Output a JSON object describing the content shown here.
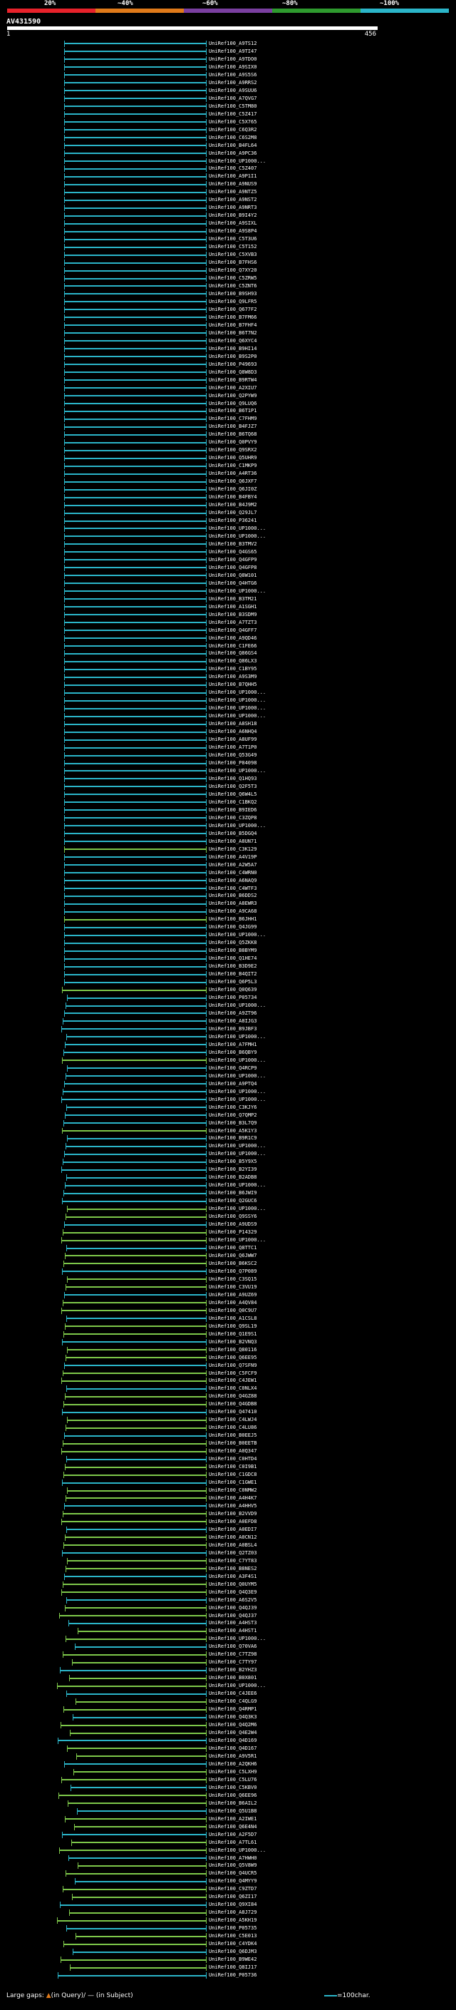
{
  "legend": {
    "labels": [
      "20%",
      "~40%",
      "~60%",
      "~80%",
      "~100%"
    ],
    "colors": [
      "#e8222b",
      "#e07a1a",
      "#7a3fa0",
      "#2e9a2e",
      "#2bb5c9"
    ]
  },
  "query_id": "AV431590",
  "scale": {
    "start": "1",
    "end": "456"
  },
  "palette": {
    "high": "#2bb5c9",
    "mid": "#7ec84a",
    "row_bg": "#1a2330"
  },
  "rows": [
    "UniRef100_A9TS12",
    "UniRef100_A9TI47",
    "UniRef100_A9TDO0",
    "UniRef100_A9SIX0",
    "UniRef100_A9S5S6",
    "UniRef100_A9RRS2",
    "UniRef100_A9SUU6",
    "UniRef100_A7QVG7",
    "UniRef100_C5TM80",
    "UniRef100_C5Z417",
    "UniRef100_C5X765",
    "UniRef100_C6Q3R2",
    "UniRef100_C6S2M8",
    "UniRef100_B4FL64",
    "UniRef100_A9PC36",
    "UniRef100_UP1000...",
    "UniRef100_C5Z407",
    "UniRef100_A9P1I1",
    "UniRef100_A9NUS9",
    "UniRef100_A9NTZ5",
    "UniRef100_A9NST2",
    "UniRef100_A9NRT3",
    "UniRef100_B9I4Y2",
    "UniRef100_A9SIXL",
    "UniRef100_A9S8P4",
    "UniRef100_C5T3U6",
    "UniRef100_C5T152",
    "UniRef100_C5XVB3",
    "UniRef100_B7FHS6",
    "UniRef100_Q7XY20",
    "UniRef100_C5ZRW5",
    "UniRef100_C5ZNT6",
    "UniRef100_B9SH93",
    "UniRef100_Q9LFR5",
    "UniRef100_Q677F2",
    "UniRef100_B7FM66",
    "UniRef100_B7FHF4",
    "UniRef100_B6T7N2",
    "UniRef100_Q6XYC4",
    "UniRef100_B9HI14",
    "UniRef100_B9S2P0",
    "UniRef100_P49693",
    "UniRef100_Q8W8D3",
    "UniRef100_B9RTW4",
    "UniRef100_A2XIU7",
    "UniRef100_Q2PYW9",
    "UniRef100_Q9LUQ6",
    "UniRef100_B6T1P1",
    "UniRef100_C7FHM9",
    "UniRef100_B4FJZ7",
    "UniRef100_B6TQ68",
    "UniRef100_Q0PVY9",
    "UniRef100_Q9SRX2",
    "UniRef100_Q5UHR9",
    "UniRef100_C1MKP9",
    "UniRef100_A4RT36",
    "UniRef100_Q6JXF7",
    "UniRef100_Q6JI0Z",
    "UniRef100_B4FBY4",
    "UniRef100_B4J9M2",
    "UniRef100_Q29JL7",
    "UniRef100_P36241",
    "UniRef100_UP1000...",
    "UniRef100_UP1000...",
    "UniRef100_B3TMV2",
    "UniRef100_Q4GS65",
    "UniRef100_Q4GFP9",
    "UniRef100_Q4GFP8",
    "UniRef100_Q8W101",
    "UniRef100_Q4HTG6",
    "UniRef100_UP1000...",
    "UniRef100_B3TM21",
    "UniRef100_A1SGH1",
    "UniRef100_B3SDM9",
    "UniRef100_A7TZT3",
    "UniRef100_Q4GFF7",
    "UniRef100_A9QD46",
    "UniRef100_C1FE66",
    "UniRef100_Q86GS4",
    "UniRef100_Q86LX3",
    "UniRef100_C1BY95",
    "UniRef100_A9S3M9",
    "UniRef100_B7QHH5",
    "UniRef100_UP1000...",
    "UniRef100_UP1000...",
    "UniRef100_UP1000...",
    "UniRef100_UP1000...",
    "UniRef100_A8SH18",
    "UniRef100_A6NHQ4",
    "UniRef100_A8UF99",
    "UniRef100_A7T1P0",
    "UniRef100_Q53G49",
    "UniRef100_P84098",
    "UniRef100_UP1000...",
    "UniRef100_Q1HQ93",
    "UniRef100_Q2F5T3",
    "UniRef100_Q6W4L5",
    "UniRef100_C1BKQ2",
    "UniRef100_B9IED6",
    "UniRef100_C3ZQP8",
    "UniRef100_UP1000...",
    "UniRef100_B5DGQ4",
    "UniRef100_A8UN71",
    "UniRef100_C3K129",
    "UniRef100_A4V19P",
    "UniRef100_A2W5A7",
    "UniRef100_C4WRN0",
    "UniRef100_A6NAQ9",
    "UniRef100_C4WTF3",
    "UniRef100_B6DDS2",
    "UniRef100_A8EWR3",
    "UniRef100_A9CA68",
    "UniRef100_B6JHH1",
    "UniRef100_Q4JG99",
    "UniRef100_UP1000...",
    "UniRef100_Q5ZKK8",
    "UniRef100_B8BYM9",
    "UniRef100_Q1HE74",
    "UniRef100_B3D9E2",
    "UniRef100_B4QIT2",
    "UniRef100_Q6P5L3",
    "UniRef100_Q0Q639",
    "UniRef100_P05734",
    "UniRef100_UP1000...",
    "UniRef100_A9ZT96",
    "UniRef100_A8IJG3",
    "UniRef100_B9JBF3",
    "UniRef100_UP1000...",
    "UniRef100_A7FMH1",
    "UniRef100_B6QBY9",
    "UniRef100_UP1000...",
    "UniRef100_Q4RCP9",
    "UniRef100_UP1000...",
    "UniRef100_A9PTQ4",
    "UniRef100_UP1000...",
    "UniRef100_UP1000...",
    "UniRef100_C3KJY6",
    "UniRef100_Q7QMP2",
    "UniRef100_B3L7Q9",
    "UniRef100_A5K1Y3",
    "UniRef100_B9R1C9",
    "UniRef100_UP1000...",
    "UniRef100_UP1000...",
    "UniRef100_B5Y9X5",
    "UniRef100_B2YI39",
    "UniRef100_B2ADB8",
    "UniRef100_UP1000...",
    "UniRef100_B6JWI9",
    "UniRef100_Q2GUC6",
    "UniRef100_UP1000...",
    "UniRef100_Q9SSY6",
    "UniRef100_A9UDS9",
    "UniRef100_P14329",
    "UniRef100_UP1000...",
    "UniRef100_Q8TTC1",
    "UniRef100_Q6JWW7",
    "UniRef100_B6KSC2",
    "UniRef100_Q7P089",
    "UniRef100_C3SQ15",
    "UniRef100_C3VU19",
    "UniRef100_A9UZ69",
    "UniRef100_A4QV84",
    "UniRef100_Q0C9U7",
    "UniRef100_A1CSL8",
    "UniRef100_Q9SL19",
    "UniRef100_Q1E9S1",
    "UniRef100_B2VNQ3",
    "UniRef100_Q80116",
    "UniRef100_Q6EE95",
    "UniRef100_Q7SFN9",
    "UniRef100_C5FCF9",
    "UniRef100_C4JEW1",
    "UniRef100_C0NLX4",
    "UniRef100_Q4GZ88",
    "UniRef100_Q4GDB8",
    "UniRef100_Q47410",
    "UniRef100_C4LWJ4",
    "UniRef100_C4LU86",
    "UniRef100_B0EEJ5",
    "UniRef100_B0EETB",
    "UniRef100_A0Q347",
    "UniRef100_C0HTD4",
    "UniRef100_C0I9B1",
    "UniRef100_C1GDC8",
    "UniRef100_C1GWE1",
    "UniRef100_C0NMW2",
    "UniRef100_A4H4K7",
    "UniRef100_A4HHV5",
    "UniRef100_B2VVD9",
    "UniRef100_A0EFD8",
    "UniRef100_A0EDI7",
    "UniRef100_A0CN12",
    "UniRef100_A0BSL4",
    "UniRef100_Q2TZ03",
    "UniRef100_C7YT83",
    "UniRef100_B8NES2",
    "UniRef100_A3F4S1",
    "UniRef100_Q0UYM5",
    "UniRef100_Q4Q3E9",
    "UniRef100_A6S2V5",
    "UniRef100_Q4QJ39",
    "UniRef100_Q4QJ37",
    "UniRef100_A4HST3",
    "UniRef100_A4HST1",
    "UniRef100_UP1000...",
    "UniRef100_Q70VA6",
    "UniRef100_C7TZ98",
    "UniRef100_C7TY97",
    "UniRef100_B2YHZ3",
    "UniRef100_B0X801",
    "UniRef100_UP1000...",
    "UniRef100_C4JEE6",
    "UniRef100_C4QLG9",
    "UniRef100_Q4RMP1",
    "UniRef100_Q4Q3K3",
    "UniRef100_Q4Q2M6",
    "UniRef100_Q4E2W4",
    "UniRef100_Q4D169",
    "UniRef100_Q4D167",
    "UniRef100_A9V5R1",
    "UniRef100_A2QKH6",
    "UniRef100_C5LXH9",
    "UniRef100_C5LU76",
    "UniRef100_C5KBV0",
    "UniRef100_Q6EE96",
    "UniRef100_B6AIL2",
    "UniRef100_Q5U1B8",
    "UniRef100_A2IWE1",
    "UniRef100_Q6E4N4",
    "UniRef100_A2F5D7",
    "UniRef100_A7TL61",
    "UniRef100_UP1000...",
    "UniRef100_A7HWH0",
    "UniRef100_Q5V8W9",
    "UniRef100_Q4UCR5",
    "UniRef100_Q4MYY9",
    "UniRef100_C9ZTD7",
    "UniRef100_Q6ZI17",
    "UniRef100_Q9XI84",
    "UniRef100_A8J729",
    "UniRef100_A5KH19",
    "UniRef100_P05735",
    "UniRef100_C5E013",
    "UniRef100_C4YDK4",
    "UniRef100_Q6DJM3",
    "UniRef100_B9WE42",
    "UniRef100_Q8IJ17",
    "UniRef100_P05736"
  ],
  "footer": {
    "large_gaps_label": "Large gaps:",
    "in_query_label": "(in Query)",
    "in_subject_label": "(in Subject)",
    "scale_note": "=100char."
  }
}
